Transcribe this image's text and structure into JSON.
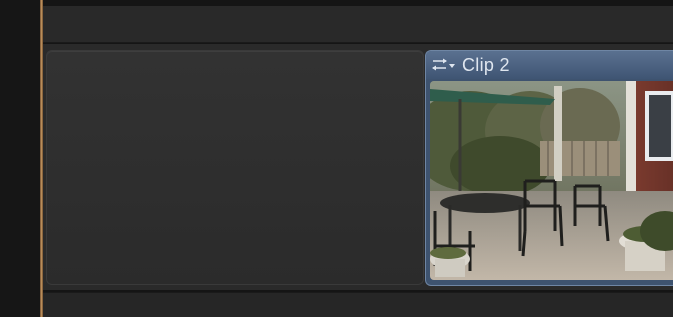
{
  "timeline": {
    "clip": {
      "name": "Clip 2",
      "menu_icon": "clip-retime-menu-icon",
      "thumbnail": "patio-scene-thumbnail"
    },
    "gap_clip": {},
    "colors": {
      "playhead": "#c79a63",
      "clip_header": "#4b6282",
      "clip_border": "#6f86a4",
      "gap_clip": "#2e2e2e",
      "background": "#151515"
    }
  }
}
